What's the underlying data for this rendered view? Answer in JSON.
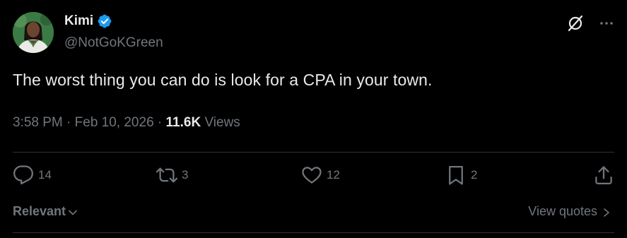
{
  "author": {
    "display_name": "Kimi",
    "handle": "@NotGoKGreen",
    "verified_color": "#1d9bf0"
  },
  "tweet": {
    "text": "The worst thing you can do is look for a CPA in your town."
  },
  "meta": {
    "time": "3:58 PM",
    "separator": "·",
    "date": "Feb 10, 2026",
    "views_count": "11.6K",
    "views_label": "Views"
  },
  "actions": {
    "replies": "14",
    "reposts": "3",
    "likes": "12",
    "bookmarks": "2"
  },
  "footer": {
    "sort_label": "Relevant",
    "view_quotes_label": "View quotes"
  },
  "icons": {
    "top": [
      "grok-icon",
      "more-icon"
    ],
    "actions": [
      "reply-icon",
      "repost-icon",
      "like-icon",
      "bookmark-icon",
      "share-icon"
    ]
  }
}
